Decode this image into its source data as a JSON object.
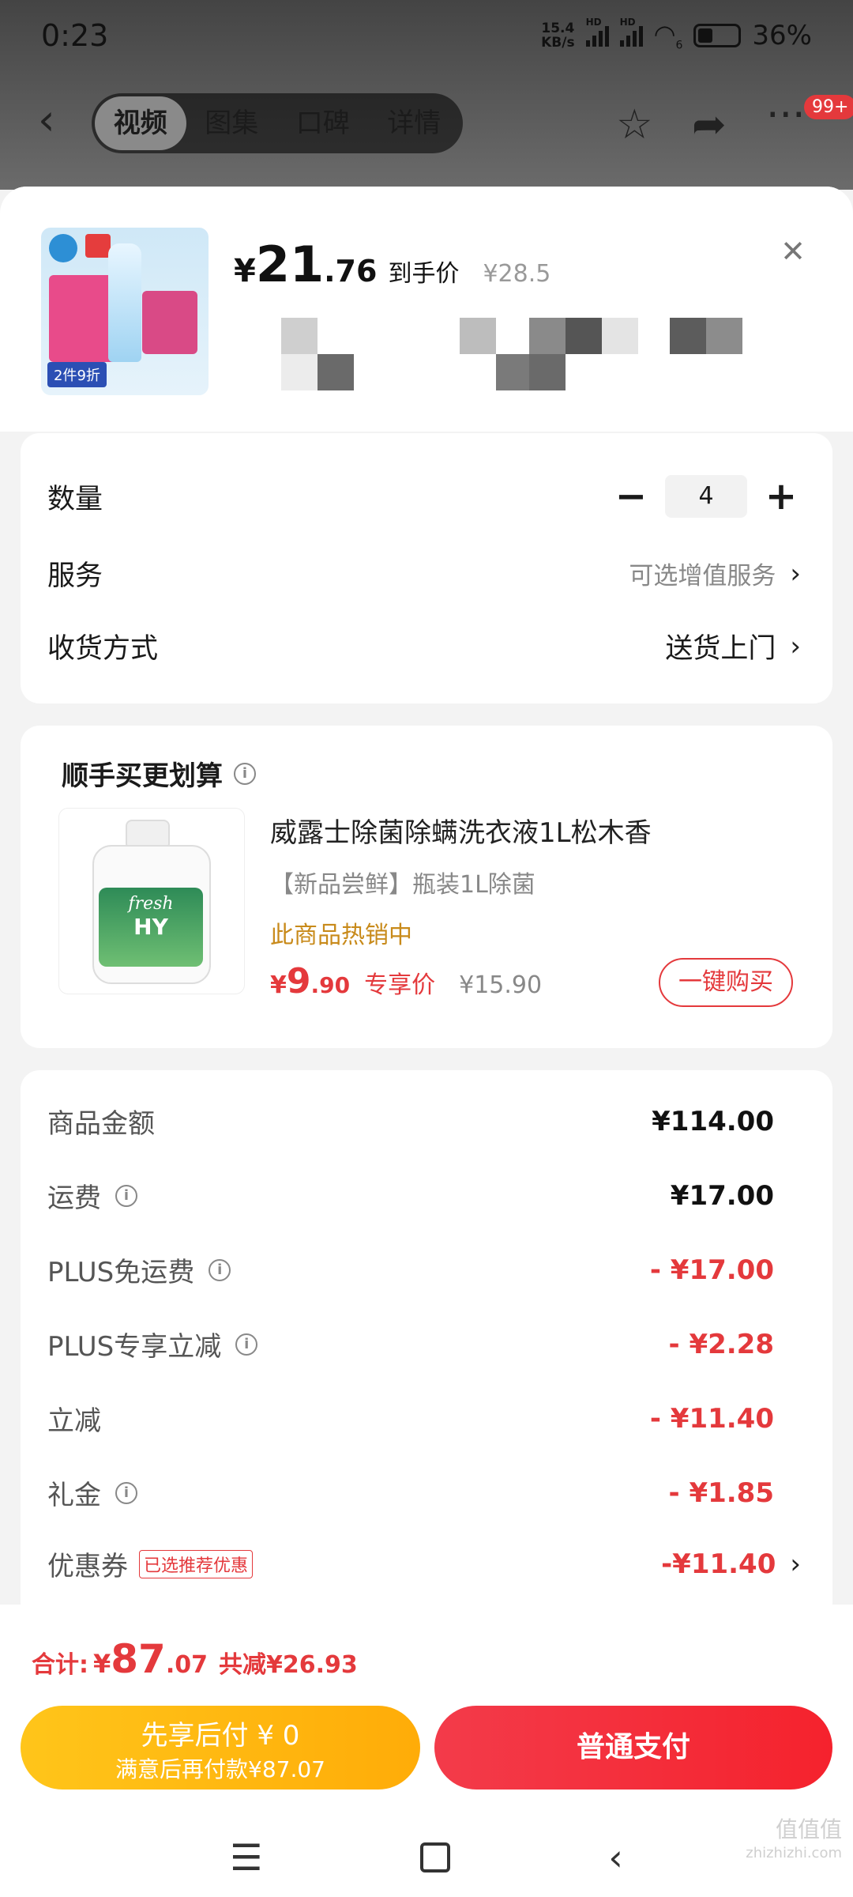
{
  "status_bar": {
    "time": "0:23",
    "net_speed_top": "15.4",
    "net_speed_bottom": "KB/s",
    "signal_tag": "HD",
    "wifi_tag": "6",
    "battery": "36%"
  },
  "nav": {
    "tabs": [
      "视频",
      "图集",
      "口碑",
      "详情"
    ],
    "active_tab": 0,
    "badge": "99+"
  },
  "product": {
    "thumb_promo": "2件9折",
    "price_yen": "¥",
    "price_int": "21",
    "price_dec": ".76",
    "price_label": "到手价",
    "price_original": "¥28.5"
  },
  "options": {
    "quantity_label": "数量",
    "quantity_value": "4",
    "service_label": "服务",
    "service_value": "可选增值服务",
    "delivery_label": "收货方式",
    "delivery_value": "送货上门"
  },
  "upsell": {
    "title": "顺手买更划算",
    "name": "威露士除菌除螨洗衣液1L松木香",
    "subtitle": "【新品尝鲜】瓶装1L除菌",
    "hot": "此商品热销中",
    "price_yen": "¥",
    "price_int": "9",
    "price_dec": ".90",
    "price_label": "专享价",
    "price_original": "¥15.90",
    "buy_button": "一键购买",
    "bottle_text_1": "fresh",
    "bottle_text_2": "HY"
  },
  "fees": [
    {
      "label": "商品金额",
      "value": "¥114.00",
      "red": false,
      "info": false
    },
    {
      "label": "运费",
      "value": "¥17.00",
      "red": false,
      "info": true
    },
    {
      "label": "PLUS免运费",
      "value": "- ¥17.00",
      "red": true,
      "info": true
    },
    {
      "label": "PLUS专享立减",
      "value": "- ¥2.28",
      "red": true,
      "info": true
    },
    {
      "label": "立减",
      "value": "- ¥11.40",
      "red": true,
      "info": false
    },
    {
      "label": "礼金",
      "value": "- ¥1.85",
      "red": true,
      "info": true
    },
    {
      "label": "优惠券",
      "value": "-¥11.40",
      "red": true,
      "info": false,
      "tag": "已选推荐优惠"
    }
  ],
  "footer": {
    "total_label": "合计:",
    "total_yen": "¥",
    "total_int": "87",
    "total_dec": ".07",
    "total_saving": "共减¥26.93",
    "pay_later_line1": "先享后付 ¥ 0",
    "pay_later_line2": "满意后再付款¥87.07",
    "pay_normal": "普通支付"
  },
  "watermark": {
    "line1": "值值值",
    "line2": "zhizhizhi.com"
  },
  "colors": {
    "accent_red": "#e4393c",
    "hot_gold": "#c88a1a",
    "pay_later_yellow": "#ffb80f"
  }
}
